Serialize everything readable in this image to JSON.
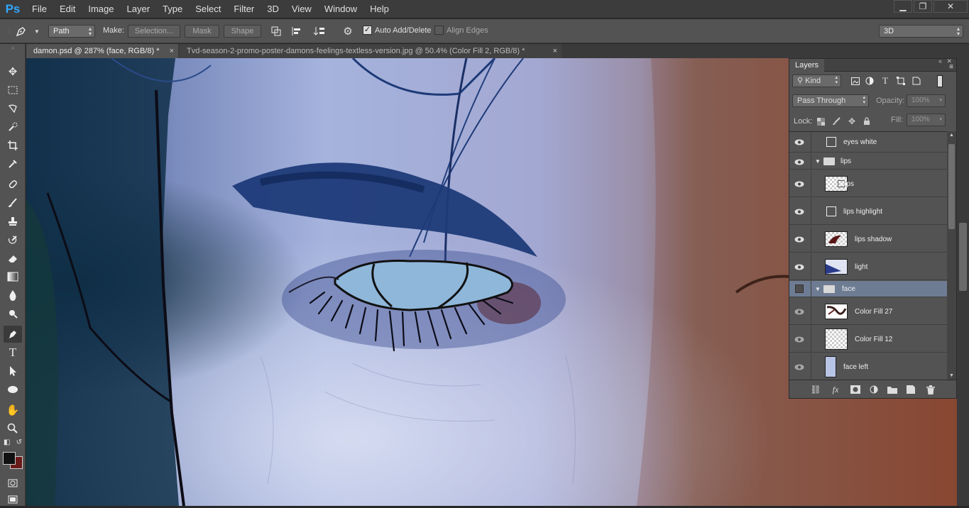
{
  "app": {
    "logo": "Ps"
  },
  "menu": [
    "File",
    "Edit",
    "Image",
    "Layer",
    "Type",
    "Select",
    "Filter",
    "3D",
    "View",
    "Window",
    "Help"
  ],
  "window_controls": {
    "minimize": "▁",
    "restore": "❐",
    "close": "✕"
  },
  "options": {
    "tool_icon": "pen-icon",
    "mode_value": "Path",
    "make_label": "Make:",
    "selection_button": "Selection...",
    "mask_button": "Mask",
    "shape_button": "Shape",
    "auto_add_delete_label": "Auto Add/Delete",
    "auto_add_delete_checked": true,
    "align_edges_label": "Align Edges",
    "align_edges_checked": false,
    "workspace_value": "3D"
  },
  "tabs": [
    {
      "label": "damon.psd @ 287% (face, RGB/8) *",
      "active": true
    },
    {
      "label": "Tvd-season-2-promo-poster-damons-feelings-textless-version.jpg @ 50.4% (Color Fill 2, RGB/8) *",
      "active": false
    }
  ],
  "tab_close": "×",
  "layers_panel": {
    "title": "Layers",
    "kind_value": "Kind",
    "blend_value": "Pass Through",
    "opacity_label": "Opacity:",
    "opacity_value": "100%",
    "lock_label": "Lock:",
    "fill_label": "Fill:",
    "fill_value": "100%",
    "layers": [
      {
        "name": "eyes white",
        "visible": true,
        "kind": "adjustment",
        "group": false,
        "selected": false
      },
      {
        "name": "lips",
        "visible": true,
        "kind": "folder",
        "group": true,
        "selected": false
      },
      {
        "name": "lips",
        "visible": true,
        "kind": "checker",
        "group": false,
        "selected": false
      },
      {
        "name": "lips highlight",
        "visible": true,
        "kind": "adjustment",
        "group": false,
        "selected": false
      },
      {
        "name": "lips shadow",
        "visible": true,
        "kind": "shadow",
        "group": false,
        "selected": false
      },
      {
        "name": "light",
        "visible": true,
        "kind": "light",
        "group": false,
        "selected": false
      },
      {
        "name": "face",
        "visible": false,
        "kind": "folder",
        "group": true,
        "selected": true
      },
      {
        "name": "Color Fill 27",
        "visible": true,
        "kind": "sketch",
        "group": false,
        "selected": false
      },
      {
        "name": "Color Fill 12",
        "visible": true,
        "kind": "checker",
        "group": false,
        "selected": false
      },
      {
        "name": "face left",
        "visible": true,
        "kind": "faceleft",
        "group": false,
        "selected": false
      }
    ]
  },
  "colors": {
    "accent": "#31a8ff",
    "foreground": "#111111",
    "background": "#6b1a1a",
    "selected_layer": "#6e7c93"
  }
}
